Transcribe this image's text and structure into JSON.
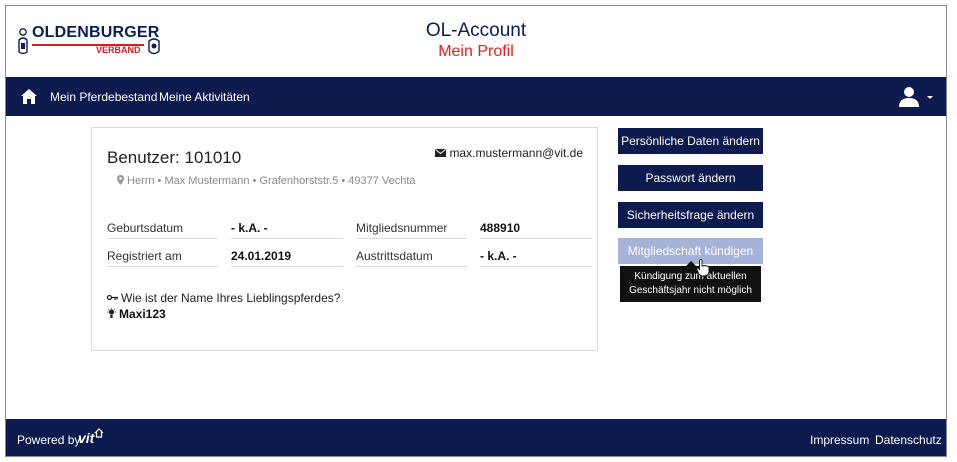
{
  "brand": {
    "logo_word": "OLDENBURGER",
    "logo_sub": "VERBAND"
  },
  "header": {
    "title": "OL-Account",
    "subtitle": "Mein Profil"
  },
  "nav": {
    "home_icon": "home-icon",
    "links": [
      "Mein Pferdebestand",
      "Meine Aktivitäten"
    ],
    "user_icon": "user-icon"
  },
  "profile": {
    "user_title": "Benutzer: 101010",
    "email": "max.mustermann@vit.de",
    "address": "Herrn • Max Mustermann • Grafenhorststr.5 • 49377 Vechta",
    "fields": {
      "geburtsdatum_label": "Geburtsdatum",
      "geburtsdatum_value": "- k.A. -",
      "mitgliedsnummer_label": "Mitgliedsnummer",
      "mitgliedsnummer_value": "488910",
      "registriert_label": "Registriert am",
      "registriert_value": "24.01.2019",
      "austritt_label": "Austrittsdatum",
      "austritt_value": "- k.A. -"
    },
    "security_question": "Wie ist der Name Ihres Lieblingspferdes?",
    "security_answer": "Maxi123"
  },
  "actions": {
    "personal_data": "Persönliche Daten ändern",
    "password": "Passwort ändern",
    "security_question": "Sicherheitsfrage ändern",
    "cancel_membership": "Mitgliedschaft kündigen",
    "tooltip_line1": "Kündigung zum aktuellen",
    "tooltip_line2": "Geschäftsjahr nicht möglich"
  },
  "footer": {
    "powered_by": "Powered by",
    "vit": "vit",
    "impressum": "Impressum",
    "datenschutz": "Datenschutz"
  },
  "colors": {
    "navy": "#0c1a4d",
    "red": "#e3201f",
    "disabled_button": "#a6b2d8"
  }
}
